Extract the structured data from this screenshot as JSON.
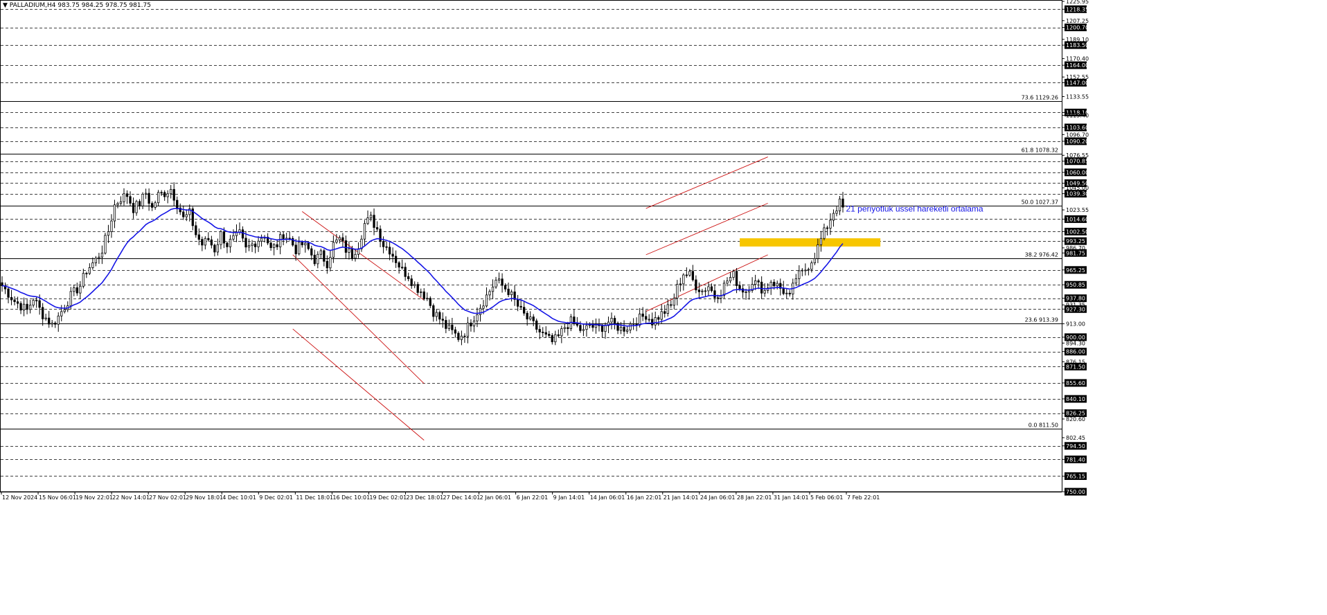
{
  "header": {
    "symbol": "PALLADIUM,H4",
    "ohlc": "983.75 984.25 978.75 981.75"
  },
  "colors": {
    "ema": "#1515e6",
    "channel": "#cc1111",
    "highlight": "#f7c600",
    "candle": "#000000",
    "grid": "#000000"
  },
  "chart_data": {
    "type": "candlestick",
    "ylim": [
      750,
      1225.95
    ],
    "y_ticks": [
      1225.95,
      1218.35,
      1207.25,
      1200.7,
      1189.1,
      1183.5,
      1170.4,
      1164.0,
      1152.55,
      1147.0,
      1133.55,
      1118.1,
      1115.4,
      1103.6,
      1096.7,
      1090.2,
      1076.55,
      1070.85,
      1060.0,
      1049.5,
      1045.0,
      1039.3,
      1023.55,
      1014.6,
      1002.5,
      993.25,
      986.7,
      981.75,
      965.25,
      950.85,
      937.8,
      931.35,
      927.3,
      913.0,
      900.0,
      894.3,
      886.0,
      876.15,
      871.5,
      855.6,
      840.1,
      826.25,
      820.6,
      802.45,
      794.5,
      781.4,
      765.15,
      750.0
    ],
    "highlighted_ticks": [
      1218.35,
      1200.7,
      1183.5,
      1164.0,
      1147.0,
      1118.1,
      1103.6,
      1090.2,
      1070.85,
      1060.0,
      1049.5,
      1039.3,
      1014.6,
      1002.5,
      993.25,
      981.75,
      965.25,
      950.85,
      937.8,
      927.3,
      900.0,
      886.0,
      871.5,
      855.6,
      840.1,
      826.25,
      794.5,
      781.4,
      765.15,
      750.0
    ],
    "dashed_levels": [
      1218.35,
      1200.7,
      1183.5,
      1164.0,
      1147.0,
      1118.1,
      1103.6,
      1090.2,
      1070.85,
      1060.0,
      1049.5,
      1039.3,
      1014.6,
      1002.5,
      993.25,
      965.25,
      950.85,
      937.8,
      927.3,
      900.0,
      886.0,
      871.5,
      855.6,
      840.1,
      826.25,
      794.5,
      781.4,
      765.15
    ],
    "fibonacci": [
      {
        "label": "73.6 1129.26",
        "value": 1129.26
      },
      {
        "label": "61.8 1078.32",
        "value": 1078.32
      },
      {
        "label": "50.0 1027.37",
        "value": 1027.37
      },
      {
        "label": "38.2 976.42",
        "value": 976.42
      },
      {
        "label": "23.6 913.39",
        "value": 913.39
      },
      {
        "label": "0.0 811.50",
        "value": 811.5
      }
    ],
    "x_labels": [
      "12 Nov 2024",
      "15 Nov 06:01",
      "19 Nov 22:01",
      "22 Nov 14:01",
      "27 Nov 02:01",
      "29 Nov 18:01",
      "4 Dec 10:01",
      "9 Dec 02:01",
      "11 Dec 18:01",
      "16 Dec 10:01",
      "19 Dec 02:01",
      "23 Dec 18:01",
      "27 Dec 14:01",
      "2 Jan 06:01",
      "6 Jan 22:01",
      "9 Jan 14:01",
      "14 Jan 06:01",
      "16 Jan 22:01",
      "21 Jan 14:01",
      "24 Jan 06:01",
      "28 Jan 22:01",
      "31 Jan 14:01",
      "5 Feb 06:01",
      "7 Feb 22:01"
    ],
    "bar_count": 270,
    "price_anchors": [
      [
        0,
        950
      ],
      [
        4,
        935
      ],
      [
        8,
        926
      ],
      [
        10,
        938
      ],
      [
        13,
        922
      ],
      [
        16,
        912
      ],
      [
        18,
        920
      ],
      [
        22,
        940
      ],
      [
        25,
        950
      ],
      [
        27,
        965
      ],
      [
        30,
        975
      ],
      [
        32,
        985
      ],
      [
        34,
        1003
      ],
      [
        36,
        1028
      ],
      [
        38,
        1035
      ],
      [
        40,
        1038
      ],
      [
        42,
        1025
      ],
      [
        44,
        1030
      ],
      [
        46,
        1040
      ],
      [
        48,
        1025
      ],
      [
        50,
        1038
      ],
      [
        52,
        1040
      ],
      [
        54,
        1044
      ],
      [
        56,
        1030
      ],
      [
        58,
        1015
      ],
      [
        60,
        1020
      ],
      [
        62,
        1000
      ],
      [
        64,
        990
      ],
      [
        66,
        995
      ],
      [
        68,
        985
      ],
      [
        70,
        1000
      ],
      [
        72,
        990
      ],
      [
        74,
        995
      ],
      [
        76,
        1000
      ],
      [
        78,
        985
      ],
      [
        80,
        990
      ],
      [
        82,
        995
      ],
      [
        84,
        1000
      ],
      [
        86,
        985
      ],
      [
        88,
        990
      ],
      [
        90,
        1000
      ],
      [
        92,
        995
      ],
      [
        94,
        985
      ],
      [
        96,
        990
      ],
      [
        98,
        985
      ],
      [
        100,
        975
      ],
      [
        102,
        980
      ],
      [
        104,
        972
      ],
      [
        106,
        990
      ],
      [
        108,
        995
      ],
      [
        110,
        985
      ],
      [
        112,
        980
      ],
      [
        114,
        990
      ],
      [
        116,
        1010
      ],
      [
        118,
        1015
      ],
      [
        120,
        1005
      ],
      [
        122,
        990
      ],
      [
        124,
        985
      ],
      [
        126,
        975
      ],
      [
        128,
        965
      ],
      [
        130,
        960
      ],
      [
        132,
        950
      ],
      [
        134,
        945
      ],
      [
        136,
        938
      ],
      [
        138,
        925
      ],
      [
        140,
        918
      ],
      [
        142,
        910
      ],
      [
        144,
        905
      ],
      [
        146,
        900
      ],
      [
        148,
        905
      ],
      [
        150,
        915
      ],
      [
        152,
        925
      ],
      [
        154,
        935
      ],
      [
        156,
        945
      ],
      [
        158,
        955
      ],
      [
        160,
        950
      ],
      [
        162,
        945
      ],
      [
        164,
        935
      ],
      [
        166,
        925
      ],
      [
        168,
        918
      ],
      [
        170,
        912
      ],
      [
        172,
        905
      ],
      [
        174,
        900
      ],
      [
        176,
        895
      ],
      [
        178,
        900
      ],
      [
        180,
        910
      ],
      [
        182,
        915
      ],
      [
        184,
        910
      ],
      [
        186,
        905
      ],
      [
        188,
        912
      ],
      [
        190,
        908
      ],
      [
        192,
        910
      ],
      [
        194,
        915
      ],
      [
        196,
        912
      ],
      [
        198,
        908
      ],
      [
        200,
        910
      ],
      [
        202,
        915
      ],
      [
        204,
        918
      ],
      [
        206,
        922
      ],
      [
        208,
        915
      ],
      [
        210,
        920
      ],
      [
        212,
        925
      ],
      [
        214,
        930
      ],
      [
        216,
        948
      ],
      [
        218,
        962
      ],
      [
        220,
        960
      ],
      [
        222,
        950
      ],
      [
        224,
        945
      ],
      [
        226,
        950
      ],
      [
        228,
        940
      ],
      [
        230,
        945
      ],
      [
        232,
        955
      ],
      [
        234,
        960
      ],
      [
        236,
        948
      ],
      [
        238,
        945
      ],
      [
        240,
        955
      ],
      [
        242,
        950
      ],
      [
        244,
        945
      ],
      [
        246,
        955
      ],
      [
        248,
        950
      ],
      [
        250,
        945
      ],
      [
        252,
        938
      ],
      [
        254,
        958
      ],
      [
        256,
        962
      ],
      [
        258,
        970
      ],
      [
        260,
        980
      ],
      [
        262,
        995
      ],
      [
        264,
        1008
      ],
      [
        266,
        1022
      ],
      [
        268,
        1030
      ],
      [
        269,
        1025
      ]
    ]
  },
  "annotations": {
    "ema_label": "21 periyotluk üssel hareketli ortalama"
  }
}
